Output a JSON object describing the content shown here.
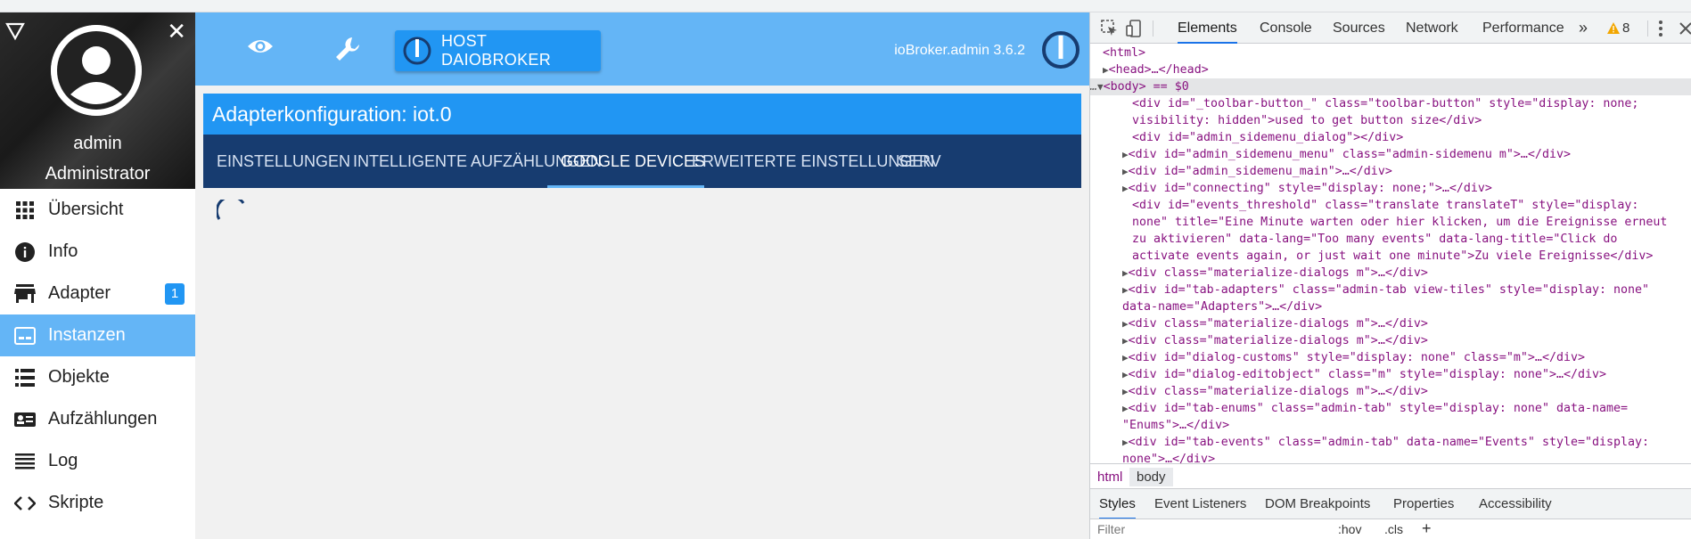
{
  "sidebar": {
    "user": "admin",
    "role": "Administrator",
    "items": [
      {
        "label": "Übersicht",
        "icon": "grid-icon"
      },
      {
        "label": "Info",
        "icon": "info-icon"
      },
      {
        "label": "Adapter",
        "icon": "store-icon",
        "badge": "1"
      },
      {
        "label": "Instanzen",
        "icon": "instances-icon",
        "active": true
      },
      {
        "label": "Objekte",
        "icon": "list-icon"
      },
      {
        "label": "Aufzählungen",
        "icon": "enum-icon"
      },
      {
        "label": "Log",
        "icon": "log-icon"
      },
      {
        "label": "Skripte",
        "icon": "code-icon"
      }
    ]
  },
  "topbar": {
    "host_button": "HOST DAIOBROKER",
    "version": "ioBroker.admin 3.6.2"
  },
  "panel": {
    "title": "Adapterkonfiguration: iot.0",
    "tabs": [
      "EINSTELLUNGEN",
      "INTELLIGENTE AUFZÄHLUNGEN",
      "GOOGLE DEVICES",
      "ERWEITERTE EINSTELLUNGEN",
      "SERV"
    ],
    "active_tab": "GOOGLE DEVICES"
  },
  "devtools": {
    "tabs": [
      "Elements",
      "Console",
      "Sources",
      "Network",
      "Performance"
    ],
    "more": "»",
    "warning_count": "8",
    "breadcrumb": [
      "html",
      "body"
    ],
    "subtabs": [
      "Styles",
      "Event Listeners",
      "DOM Breakpoints",
      "Properties",
      "Accessibility"
    ],
    "filter_placeholder": "Filter",
    "filter_hov": ":hov",
    "filter_cls": ".cls",
    "dom": {
      "l1": "<html>",
      "l2": "<head>…</head>",
      "l3": "<body> == $0",
      "l4": "<div id=\"_toolbar-button_\" class=\"toolbar-button\" style=\"display: none;",
      "l5": "visibility: hidden\">used to get button size</div>",
      "l6": "<div id=\"admin_sidemenu_dialog\"></div>",
      "l7": "<div id=\"admin_sidemenu_menu\" class=\"admin-sidemenu m\">…</div>",
      "l8": "<div id=\"admin_sidemenu_main\">…</div>",
      "l9": "<div id=\"connecting\" style=\"display: none;\">…</div>",
      "l10": "<div id=\"events_threshold\" class=\"translate translateT\" style=\"display:",
      "l11": "none\" title=\"Eine Minute warten oder hier klicken, um die Ereignisse erneut",
      "l12": "zu aktivieren\" data-lang=\"Too many events\" data-lang-title=\"Click do",
      "l13": "activate events again, or just wait one minute\">Zu viele Ereignisse</div>",
      "l14": "<div class=\"materialize-dialogs m\">…</div>",
      "l15": "<div id=\"tab-adapters\" class=\"admin-tab view-tiles\" style=\"display: none\"",
      "l16": "data-name=\"Adapters\">…</div>",
      "l17": "<div class=\"materialize-dialogs m\">…</div>",
      "l18": "<div class=\"materialize-dialogs m\">…</div>",
      "l19": "<div id=\"dialog-customs\" style=\"display: none\" class=\"m\">…</div>",
      "l20": "<div id=\"dialog-editobject\" class=\"m\" style=\"display: none\">…</div>",
      "l21": "<div class=\"materialize-dialogs m\">…</div>",
      "l22": "<div id=\"tab-enums\" class=\"admin-tab\" style=\"display: none\" data-name=",
      "l23": "\"Enums\">…</div>",
      "l24": "<div id=\"tab-events\" class=\"admin-tab\" data-name=\"Events\" style=\"display:",
      "l25": "none\">…</div>"
    }
  },
  "colors": {
    "sidebar_active": "#64b5f6",
    "topbar": "#64b5f6",
    "panel_title": "#2196f3",
    "tabs_bg": "#173c70",
    "tab_indicator": "#64b5f6"
  }
}
